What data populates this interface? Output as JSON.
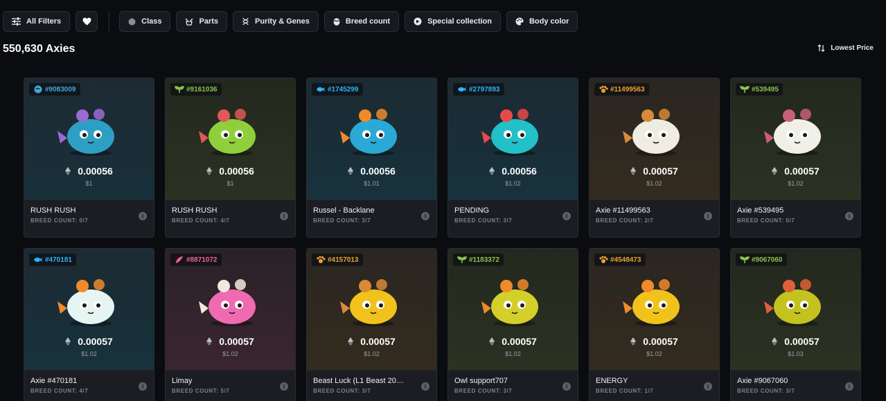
{
  "filters": {
    "all_filters": "All Filters",
    "class": "Class",
    "parts": "Parts",
    "purity_genes": "Purity & Genes",
    "breed_count": "Breed count",
    "special_collection": "Special collection",
    "body_color": "Body color"
  },
  "results_count": "550,630 Axies",
  "sort_label": "Lowest Price",
  "cards": [
    {
      "id": "#9083009",
      "class": "aquatic-round",
      "class_color": "#3fa8d8",
      "price": "0.00056",
      "usd": "$1",
      "name": "RUSH RUSH",
      "breed": "BREED COUNT: 0/7",
      "body": "#2e9fc4",
      "accent": "#9b6ad6",
      "bg": [
        "#1e2a33",
        "#18303a"
      ]
    },
    {
      "id": "#9161036",
      "class": "plant",
      "class_color": "#8bc34a",
      "price": "0.00056",
      "usd": "$1",
      "name": "RUSH RUSH",
      "breed": "BREED COUNT: 4/7",
      "body": "#8fcf3c",
      "accent": "#e05858",
      "bg": [
        "#23281e",
        "#2b3222"
      ]
    },
    {
      "id": "#1745299",
      "class": "aquatic",
      "class_color": "#29b6f6",
      "price": "0.00056",
      "usd": "$1.01",
      "name": "Russel - Backlane",
      "breed": "BREED COUNT: 3/7",
      "body": "#2ba9d6",
      "accent": "#f08a2a",
      "bg": [
        "#1c2a33",
        "#17323c"
      ]
    },
    {
      "id": "#2797893",
      "class": "aquatic",
      "class_color": "#29b6f6",
      "price": "0.00056",
      "usd": "$1.02",
      "name": "PENDING",
      "breed": "BREED COUNT: 3/7",
      "body": "#23c0c8",
      "accent": "#e84a4a",
      "bg": [
        "#1c2a33",
        "#17323c"
      ]
    },
    {
      "id": "#11499563",
      "class": "beast",
      "class_color": "#f0a030",
      "price": "0.00057",
      "usd": "$1.02",
      "name": "Axie #11499563",
      "breed": "BREED COUNT: 2/7",
      "body": "#efece2",
      "accent": "#d88a3a",
      "bg": [
        "#2a2620",
        "#332b1f"
      ]
    },
    {
      "id": "#539495",
      "class": "plant",
      "class_color": "#8bc34a",
      "price": "0.00057",
      "usd": "$1.02",
      "name": "Axie #539495",
      "breed": "BREED COUNT: 0/7",
      "body": "#f1f0e8",
      "accent": "#c8607a",
      "bg": [
        "#23281e",
        "#2b3222"
      ]
    },
    {
      "id": "#470181",
      "class": "aquatic",
      "class_color": "#29b6f6",
      "price": "0.00057",
      "usd": "$1.02",
      "name": "Axie #470181",
      "breed": "BREED COUNT: 4/7",
      "body": "#e6f4f2",
      "accent": "#f08a2a",
      "bg": [
        "#1c2a33",
        "#17323c"
      ]
    },
    {
      "id": "#8871072",
      "class": "bird",
      "class_color": "#f06292",
      "price": "0.00057",
      "usd": "$1.02",
      "name": "Limay",
      "breed": "BREED COUNT: 5/7",
      "body": "#f06ab2",
      "accent": "#f2e8e0",
      "bg": [
        "#2a2228",
        "#3a2530"
      ]
    },
    {
      "id": "#4157013",
      "class": "beast",
      "class_color": "#f0a030",
      "price": "0.00057",
      "usd": "$1.02",
      "name": "Beast Luck (L1 Beast 20…",
      "breed": "BREED COUNT: 3/7",
      "body": "#f2c21c",
      "accent": "#d88a3a",
      "bg": [
        "#2a2620",
        "#332b1f"
      ]
    },
    {
      "id": "#1183372",
      "class": "plant",
      "class_color": "#8bc34a",
      "price": "0.00057",
      "usd": "$1.02",
      "name": "Owl support707",
      "breed": "BREED COUNT: 3/7",
      "body": "#d4cf2a",
      "accent": "#f08a2a",
      "bg": [
        "#23281e",
        "#2b3222"
      ]
    },
    {
      "id": "#4548473",
      "class": "beast",
      "class_color": "#f0a030",
      "price": "0.00057",
      "usd": "$1.02",
      "name": "ENERGY",
      "breed": "BREED COUNT: 1/7",
      "body": "#f2c21c",
      "accent": "#f08a2a",
      "bg": [
        "#2a2620",
        "#332b1f"
      ]
    },
    {
      "id": "#9067060",
      "class": "plant",
      "class_color": "#8bc34a",
      "price": "0.00057",
      "usd": "$1.03",
      "name": "Axie #9067060",
      "breed": "BREED COUNT: 3/7",
      "body": "#c4c21f",
      "accent": "#e0603a",
      "bg": [
        "#23281e",
        "#2b3222"
      ]
    }
  ]
}
